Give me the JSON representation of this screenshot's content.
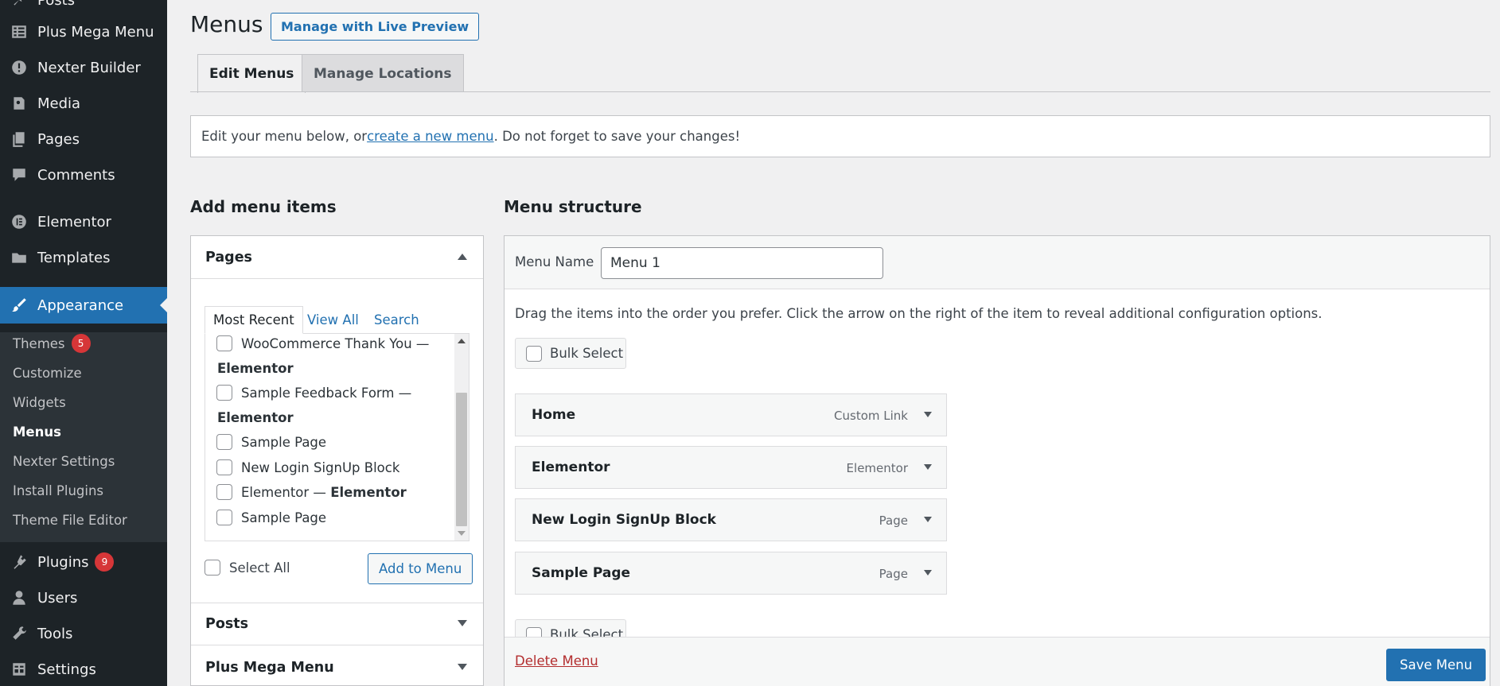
{
  "sidebar": {
    "items": [
      {
        "label": "Posts",
        "icon": "pushpin-icon"
      },
      {
        "label": "Plus Mega Menu",
        "icon": "table-icon"
      },
      {
        "label": "Nexter Builder",
        "icon": "info-circle-icon"
      },
      {
        "label": "Media",
        "icon": "media-icon"
      },
      {
        "label": "Pages",
        "icon": "pages-icon"
      },
      {
        "label": "Comments",
        "icon": "comment-icon"
      },
      {
        "label": "Elementor",
        "icon": "elementor-icon"
      },
      {
        "label": "Templates",
        "icon": "folder-icon"
      },
      {
        "label": "Appearance",
        "icon": "brush-icon"
      },
      {
        "label": "Plugins",
        "icon": "plugin-icon",
        "badge": "9"
      },
      {
        "label": "Users",
        "icon": "user-icon"
      },
      {
        "label": "Tools",
        "icon": "wrench-icon"
      },
      {
        "label": "Settings",
        "icon": "settings-icon"
      }
    ],
    "submenu": [
      {
        "label": "Themes",
        "badge": "5"
      },
      {
        "label": "Customize"
      },
      {
        "label": "Widgets"
      },
      {
        "label": "Menus"
      },
      {
        "label": "Nexter Settings"
      },
      {
        "label": "Install Plugins"
      },
      {
        "label": "Theme File Editor"
      }
    ]
  },
  "header": {
    "title": "Menus",
    "live_preview_label": "Manage with Live Preview",
    "tabs": [
      {
        "label": "Edit Menus"
      },
      {
        "label": "Manage Locations"
      }
    ]
  },
  "notice": {
    "prefix": "Edit your menu below, or ",
    "link": "create a new menu",
    "suffix": ". Do not forget to save your changes!"
  },
  "add_items": {
    "title": "Add menu items",
    "pages_heading": "Pages",
    "tabs": {
      "recent": "Most Recent",
      "all": "View All",
      "search": "Search"
    },
    "list": [
      {
        "label": "WooCommerce Thank You —",
        "bold": "Elementor"
      },
      {
        "label": "Sample Feedback Form —",
        "bold": "Elementor"
      },
      {
        "label": "Sample Page"
      },
      {
        "label": "New Login SignUp Block"
      },
      {
        "label": "Elementor — ",
        "bold": "Elementor"
      },
      {
        "label": "Sample Page"
      }
    ],
    "select_all_label": "Select All",
    "add_button": "Add to Menu",
    "posts_heading": "Posts",
    "mega_menu_heading": "Plus Mega Menu"
  },
  "structure": {
    "title": "Menu structure",
    "menu_name_label": "Menu Name",
    "menu_name_value": "Menu 1",
    "help_text": "Drag the items into the order you prefer. Click the arrow on the right of the item to reveal additional configuration options.",
    "bulk_select_label": "Bulk Select",
    "items": [
      {
        "title": "Home",
        "type": "Custom Link"
      },
      {
        "title": "Elementor",
        "type": "Elementor"
      },
      {
        "title": "New Login SignUp Block",
        "type": "Page"
      },
      {
        "title": "Sample Page",
        "type": "Page"
      }
    ],
    "delete_label": "Delete Menu",
    "save_label": "Save Menu"
  }
}
